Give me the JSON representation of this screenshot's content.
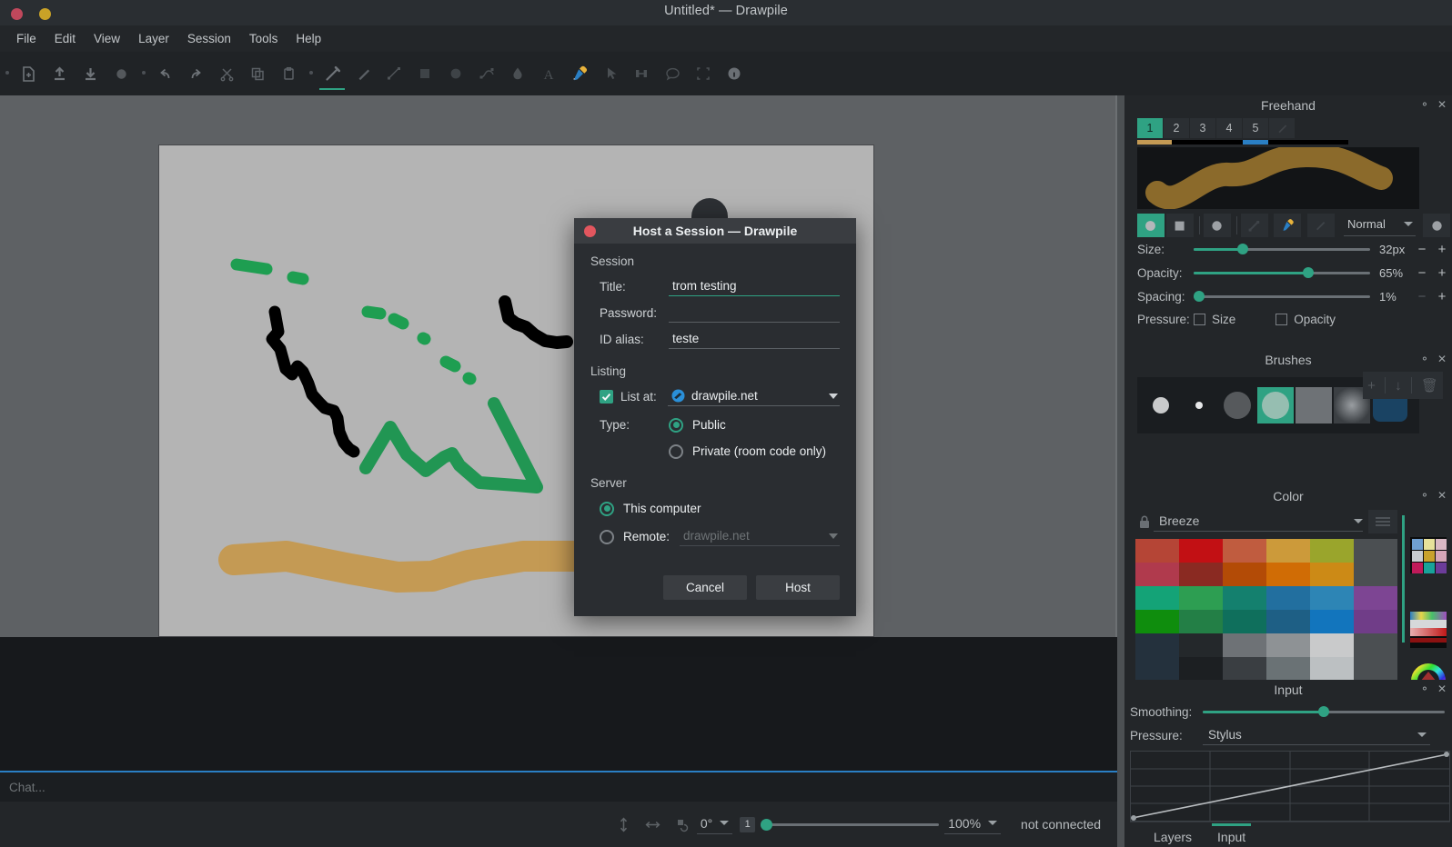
{
  "window": {
    "title": "Untitled* — Drawpile",
    "close_icon": "close-circle-icon",
    "minimize_icon": "minimize-circle-icon"
  },
  "menubar": {
    "items": [
      {
        "label": "File"
      },
      {
        "label": "Edit"
      },
      {
        "label": "View"
      },
      {
        "label": "Layer"
      },
      {
        "label": "Session"
      },
      {
        "label": "Tools"
      },
      {
        "label": "Help"
      }
    ]
  },
  "toolbar": {
    "items": [
      {
        "name": "new-document-icon",
        "label": "New"
      },
      {
        "name": "open-document-icon",
        "label": "Open"
      },
      {
        "name": "save-document-icon",
        "label": "Save"
      },
      {
        "name": "record-icon",
        "label": "Record"
      },
      {
        "name": "undo-icon",
        "label": "Undo"
      },
      {
        "name": "redo-icon",
        "label": "Redo"
      },
      {
        "name": "cut-icon",
        "label": "Cut"
      },
      {
        "name": "copy-icon",
        "label": "Copy"
      },
      {
        "name": "paste-icon",
        "label": "Paste"
      },
      {
        "name": "freehand-brush-icon",
        "label": "Freehand"
      },
      {
        "name": "eraser-icon",
        "label": "Eraser"
      },
      {
        "name": "line-icon",
        "label": "Line"
      },
      {
        "name": "rectangle-icon",
        "label": "Rectangle"
      },
      {
        "name": "ellipse-icon",
        "label": "Ellipse"
      },
      {
        "name": "bezier-icon",
        "label": "Bezier"
      },
      {
        "name": "fill-icon",
        "label": "Flood Fill"
      },
      {
        "name": "text-icon",
        "label": "Text"
      },
      {
        "name": "color-picker-icon",
        "label": "Color Picker"
      },
      {
        "name": "select-icon",
        "label": "Select"
      },
      {
        "name": "transform-icon",
        "label": "Transform"
      },
      {
        "name": "annotation-icon",
        "label": "Annotation"
      },
      {
        "name": "zoom-select-icon",
        "label": "Zoom"
      },
      {
        "name": "inspector-icon",
        "label": "Inspector"
      }
    ],
    "active_index": 9
  },
  "canvas": {
    "background": "#b4b4b4",
    "strokes": [
      {
        "name": "green-dashes-upper",
        "color": "#1e9e51"
      },
      {
        "name": "black-zigzag",
        "color": "#000000"
      },
      {
        "name": "green-zigzag",
        "color": "#219653"
      },
      {
        "name": "tan-wave",
        "color": "#c49a54"
      },
      {
        "name": "black-stroke-right",
        "color": "#000000"
      }
    ]
  },
  "chat": {
    "placeholder": "Chat..."
  },
  "statusbar": {
    "vertical_flip_icon": "flip-vertical-icon",
    "horizontal_flip_icon": "flip-horizontal-icon",
    "rotate_reset_icon": "rotate-reset-icon",
    "angle": "0°",
    "layer_number": "1",
    "zoom": "100%",
    "connection": "not connected"
  },
  "docks": {
    "freehand": {
      "title": "Freehand",
      "config_icon": "gear-small-icon",
      "close_icon": "close-x-icon",
      "slots": [
        {
          "label": "1",
          "active": true,
          "bar": "#c49a54"
        },
        {
          "label": "2",
          "active": false,
          "bar": "#000000"
        },
        {
          "label": "3",
          "active": false,
          "bar": "#000000"
        },
        {
          "label": "4",
          "active": false,
          "bar": "#2a7fc4"
        },
        {
          "label": "5",
          "active": false,
          "bar": "#000000"
        },
        {
          "label": "",
          "active": false,
          "bar": "#000000",
          "icon": "eraser-slot-icon"
        }
      ],
      "preview": {
        "name": "brush-stroke-preview",
        "stroke_color": "#8b6a2b",
        "background": "#121416"
      },
      "mode_buttons": [
        {
          "name": "brush-soft-round-button",
          "active": true
        },
        {
          "name": "brush-hard-square-button",
          "active": false
        },
        {
          "name": "brush-round-button",
          "active": false
        },
        {
          "name": "brush-smudge-button",
          "active": false
        },
        {
          "name": "color-picker-button",
          "active": false
        },
        {
          "name": "eraser-button",
          "active": false
        }
      ],
      "blend_mode": "Normal",
      "sliders": [
        {
          "label": "Size:",
          "value": "32px",
          "pct": 28,
          "plus": "+",
          "minus": "−",
          "dim": false
        },
        {
          "label": "Opacity:",
          "value": "65%",
          "pct": 65,
          "plus": "+",
          "minus": "−",
          "dim": false
        },
        {
          "label": "Spacing:",
          "value": "1%",
          "pct": 2,
          "plus": "+",
          "minus": "−",
          "dim": true
        }
      ],
      "pressure_label": "Pressure:",
      "pressure_size": "Size",
      "pressure_opacity": "Opacity"
    },
    "brushes": {
      "title": "Brushes",
      "config_icon": "gear-small-icon",
      "close_icon": "close-x-icon",
      "add_icon": "plus-icon",
      "import_icon": "download-icon",
      "delete_icon": "trash-icon",
      "swatches": [
        {
          "name": "brush-preset-1",
          "color": "#c9cacb",
          "size": 26,
          "selected": false
        },
        {
          "name": "brush-preset-2",
          "color": "#e7e8e9",
          "size": 10,
          "selected": false
        },
        {
          "name": "brush-preset-3",
          "color": "#56595c",
          "size": 36,
          "selected": false
        },
        {
          "name": "brush-preset-4",
          "color": "#8fb9ac",
          "size": 34,
          "selected": true
        },
        {
          "name": "brush-preset-5",
          "color": "#6e7276",
          "size": 40,
          "selected": false
        },
        {
          "name": "brush-preset-6",
          "color": "#75797d",
          "size": 40,
          "selected": false
        },
        {
          "name": "brush-preset-7",
          "color": "#1a4363",
          "size": 40,
          "selected": false
        }
      ],
      "selection_color": "#2fa283"
    },
    "color": {
      "title": "Color",
      "config_icon": "gear-small-icon",
      "close_icon": "close-x-icon",
      "lock_icon": "lock-icon",
      "palette_name": "Breeze",
      "menu_icon": "hamburger-icon",
      "palette": [
        "#b54536",
        "#c21014",
        "#c05c3f",
        "#cc9a3a",
        "#9aa52c",
        "#4b4f52",
        "#b03a4d",
        "#8a2a22",
        "#b34b06",
        "#d06c05",
        "#cc8a16",
        "#4b4f52",
        "#14a377",
        "#2d9e52",
        "#14806e",
        "#226f9f",
        "#2d85b5",
        "#7d4593",
        "#0f8d0d",
        "#237f46",
        "#0f6f5c",
        "#1e5f85",
        "#1275bd",
        "#703d88",
        "#24313d",
        "#24282b",
        "#6e7276",
        "#8e9295",
        "#c9cacb",
        "#4b4f52",
        "#24313d",
        "#1c1f22",
        "#3a3e42",
        "#6a7275",
        "#bcc0c2",
        "#4b4f52"
      ],
      "recent": [
        "#c49a54",
        "#2a7fc4",
        "#219653",
        "#000000"
      ],
      "mini_grid_icon": "palette-grid-icon",
      "mini_gradient_icon": "gradient-strip-icon",
      "wheel_icon": "color-wheel-icon",
      "accent": "#2fa283"
    },
    "input": {
      "title": "Input",
      "config_icon": "gear-small-icon",
      "close_icon": "close-x-icon",
      "smoothing_label": "Smoothing:",
      "smoothing_pct": 50,
      "pressure_label": "Pressure:",
      "pressure_source": "Stylus",
      "curve_name": "pressure-curve-graph"
    },
    "tabs": [
      {
        "label": "Layers",
        "active": false
      },
      {
        "label": "Input",
        "active": true
      }
    ]
  },
  "dialog": {
    "title": "Host a Session — Drawpile",
    "close_icon": "close-circle-icon",
    "groups": {
      "session": "Session",
      "listing": "Listing",
      "server": "Server"
    },
    "fields": {
      "title_label": "Title:",
      "title_value": "trom testing",
      "password_label": "Password:",
      "password_value": "",
      "password_placeholder": "",
      "idalias_label": "ID alias:",
      "idalias_value": "teste"
    },
    "listing": {
      "list_at_label": "List at:",
      "list_at_checked": true,
      "list_at_value": "drawpile.net",
      "list_at_icon": "drawpile-globe-icon",
      "type_label": "Type:",
      "type_public": "Public",
      "type_private": "Private (room code only)",
      "type_selected": "Public"
    },
    "server": {
      "this_computer": "This computer",
      "remote_label": "Remote:",
      "remote_placeholder": "drawpile.net",
      "selected": "This computer"
    },
    "buttons": {
      "cancel": "Cancel",
      "host": "Host"
    }
  }
}
